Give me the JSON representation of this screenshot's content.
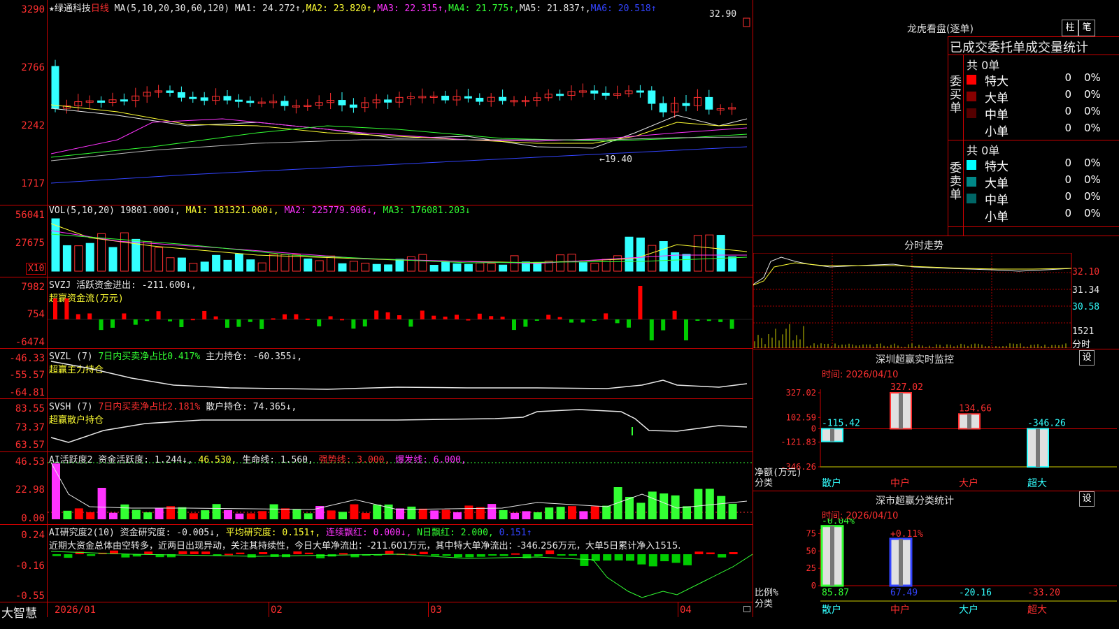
{
  "stock": {
    "name": "★绿通科技",
    "period": "日线"
  },
  "main": {
    "ma_label": "MA(5,10,20,30,60,120)",
    "ma1": "MA1: 24.272↑,",
    "ma2": "MA2: 23.820↑,",
    "ma3": "MA3: 22.315↑,",
    "ma4": "MA4: 21.775↑,",
    "ma5": "MA5: 21.837↑,",
    "ma6": "MA6: 20.518↑",
    "y_ticks": [
      "3290",
      "2766",
      "2242",
      "1717"
    ],
    "high_label": "32.90",
    "low_label": "←19.40"
  },
  "volume": {
    "label": "VOL(5,10,20)",
    "value": "19801.000↓,",
    "ma1": "MA1: 181321.000↓,",
    "ma2": "MA2: 225779.906↓,",
    "ma3": "MA3: 176081.203↓",
    "y_ticks": [
      "56041",
      "27675"
    ],
    "unit": "X10"
  },
  "svzj": {
    "label": "SVZJ  活跃资金进出: -211.600↓,",
    "sub": "超赢资金流(万元)",
    "y_ticks": [
      "7982",
      "754",
      "-6474"
    ]
  },
  "svzl": {
    "label": "SVZL (7)",
    "ratio": "7日内买卖净占比0.417%",
    "hold": "主力持仓: -60.355↓,",
    "sub": "超赢主力持仓",
    "y_ticks": [
      "-46.33",
      "-55.57",
      "-64.81"
    ]
  },
  "svsh": {
    "label": "SVSH (7)",
    "ratio": "7日内买卖净占比2.181%",
    "hold": "散户持仓: 74.365↓,",
    "sub": "超赢散户持仓",
    "y_ticks": [
      "83.55",
      "73.37",
      "63.57"
    ]
  },
  "ai_active": {
    "label": "AI活跃度2 资金活跃度: 1.244↓,",
    "v2": "46.530,",
    "life": "生命线: 1.560,",
    "strong": "强势线: 3.000,",
    "burst": "爆发线: 6.000,",
    "y_ticks": [
      "46.53",
      "22.98",
      "0.00"
    ]
  },
  "ai_research": {
    "label": "AI研究度2(10) 资金研究度: -0.005↓,",
    "avg": "平均研究度: 0.151↑,",
    "red_cont": "连续飘红: 0.000↓,",
    "red_n": "N日飘红: 2.000,",
    "last": "0.151↑",
    "comment": "近期大资金总体由空转多，近两日出现异动，关注其持续性，今日大单净流出：-211.601万元，其中特大单净流出：-346.256万元，大单5日累计净入1515.",
    "y_ticks": [
      "0.24",
      "-0.16",
      "-0.55"
    ]
  },
  "time_axis": {
    "logo": "大智慧",
    "labels": [
      "2026/01",
      "02",
      "03",
      "04"
    ]
  },
  "right": {
    "title": "龙虎看盘(逐单)",
    "btn_bar": "柱",
    "btn_count": "笔",
    "subtitle": "已成交委托单成交量统计",
    "buy": {
      "side": "委买单",
      "total": "共 0单",
      "rows": [
        {
          "name": "特大",
          "count": "0",
          "pct": "0%",
          "color": "#ff0000"
        },
        {
          "name": "大单",
          "count": "0",
          "pct": "0%",
          "color": "#880000"
        },
        {
          "name": "中单",
          "count": "0",
          "pct": "0%",
          "color": "#550000"
        },
        {
          "name": "小单",
          "count": "0",
          "pct": "0%",
          "color": "#000000"
        }
      ]
    },
    "sell": {
      "side": "委卖单",
      "total": "共 0单",
      "rows": [
        {
          "name": "特大",
          "count": "0",
          "pct": "0%",
          "color": "#00ffff"
        },
        {
          "name": "大单",
          "count": "0",
          "pct": "0%",
          "color": "#008888"
        },
        {
          "name": "中单",
          "count": "0",
          "pct": "0%",
          "color": "#006666"
        },
        {
          "name": "小单",
          "count": "0",
          "pct": "0%",
          "color": "#000000"
        }
      ]
    },
    "intraday": {
      "title": "分时走势",
      "p1": "32.10",
      "p2": "31.34",
      "p3": "30.58",
      "vol": "1521",
      "unit": "分时"
    },
    "sz_monitor": {
      "title": "深圳超赢实时监控",
      "btn": "设",
      "time": "时间: 2026/04/10",
      "y_ticks": [
        "327.02",
        "102.59",
        "0",
        "-121.83",
        "-346.26"
      ],
      "ylabel": "净额(万元)",
      "xlabel": "分类",
      "bar_labels": [
        "-115.42",
        "327.02",
        "134.66",
        "-346.26"
      ]
    },
    "sz_class": {
      "title": "深市超赢分类统计",
      "btn": "设",
      "time": "时间: 2026/04/10",
      "y_ticks": [
        "75",
        "50",
        "25",
        "0"
      ],
      "ylabel": "比例%",
      "xlabel": "分类",
      "top_labels": [
        "-0.04%",
        "+0.11%"
      ],
      "bottom_values": [
        "85.87",
        "67.49",
        "-20.16",
        "-33.20"
      ]
    }
  },
  "chart_data": [
    {
      "type": "bar",
      "title": "深圳超赢实时监控",
      "categories": [
        "散户",
        "中户",
        "大户",
        "超大"
      ],
      "values": [
        -115.42,
        327.02,
        134.66,
        -346.26
      ],
      "ylabel": "净额(万元)",
      "xlabel": "分类",
      "ylim": [
        -346.26,
        327.02
      ]
    },
    {
      "type": "bar",
      "title": "深市超赢分类统计",
      "categories": [
        "散户",
        "中户",
        "大户",
        "超大"
      ],
      "values": [
        85.87,
        67.49,
        -20.16,
        -33.2
      ],
      "ylabel": "比例%",
      "xlabel": "分类",
      "ylim": [
        0,
        75
      ]
    }
  ]
}
